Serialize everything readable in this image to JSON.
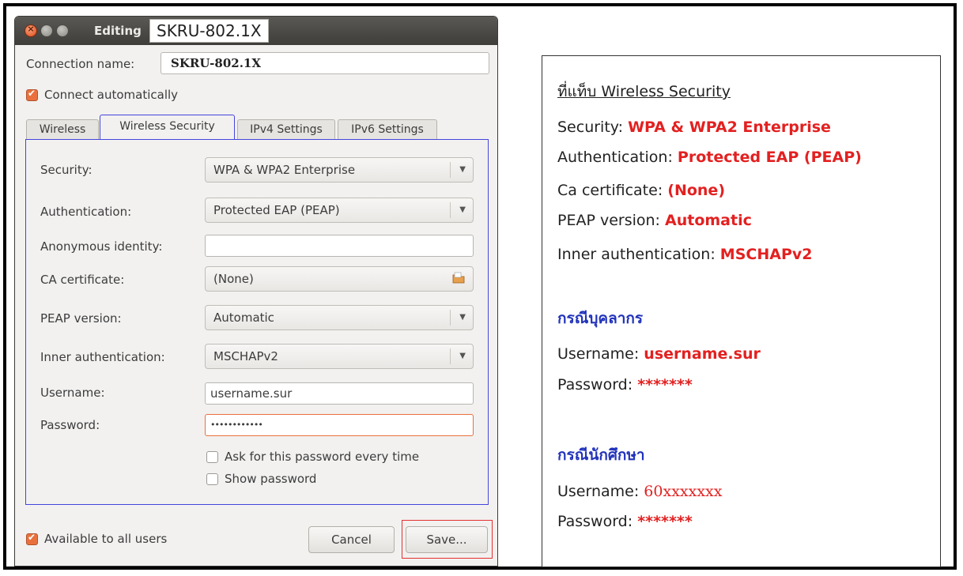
{
  "window": {
    "title_prefix": "Editing",
    "title_name": "SKRU-802.1X",
    "connection_name_label": "Connection name:",
    "connection_name_value": "SKRU-802.1X",
    "connect_automatically_label": "Connect automatically",
    "tabs": [
      {
        "label": "Wireless"
      },
      {
        "label": "Wireless Security"
      },
      {
        "label": "IPv4 Settings"
      },
      {
        "label": "IPv6 Settings"
      }
    ],
    "fields": {
      "security_label": "Security:",
      "security_value": "WPA & WPA2 Enterprise",
      "authentication_label": "Authentication:",
      "authentication_value": "Protected EAP (PEAP)",
      "anonymous_identity_label": "Anonymous identity:",
      "anonymous_identity_value": "",
      "ca_certificate_label": "CA certificate:",
      "ca_certificate_value": "(None)",
      "peap_version_label": "PEAP version:",
      "peap_version_value": "Automatic",
      "inner_auth_label": "Inner authentication:",
      "inner_auth_value": "MSCHAPv2",
      "username_label": "Username:",
      "username_value": "username.sur",
      "password_label": "Password:",
      "password_value": "••••••••••••",
      "ask_password_label": "Ask for this password every time",
      "show_password_label": "Show password"
    },
    "available_all_users_label": "Available to all users",
    "cancel_label": "Cancel",
    "save_label": "Save..."
  },
  "info": {
    "heading": "ที่แท็บ Wireless Security",
    "security_label": "Security: ",
    "security_value": "WPA & WPA2 Enterprise",
    "authentication_label": "Authentication: ",
    "authentication_value": "Protected EAP (PEAP)",
    "ca_label": "Ca certificate: ",
    "ca_value": "(None)",
    "peap_label": "PEAP version: ",
    "peap_value": "Automatic",
    "inner_label": "Inner authentication: ",
    "inner_value": "MSCHAPv2",
    "staff_heading": "กรณีบุคลากร",
    "staff_username_label": "Username: ",
    "staff_username_value": "username.sur",
    "staff_password_label": "Password: ",
    "staff_password_value": "*******",
    "student_heading": "กรณีนักศึกษา",
    "student_username_label": "Username: ",
    "student_username_value": "60xxxxxxx",
    "student_password_label": "Password: ",
    "student_password_value": "*******"
  },
  "colors": {
    "accent_orange": "#e9703d",
    "highlight_blue": "#4444dd",
    "highlight_red": "#e53030",
    "value_red": "#e32020"
  }
}
